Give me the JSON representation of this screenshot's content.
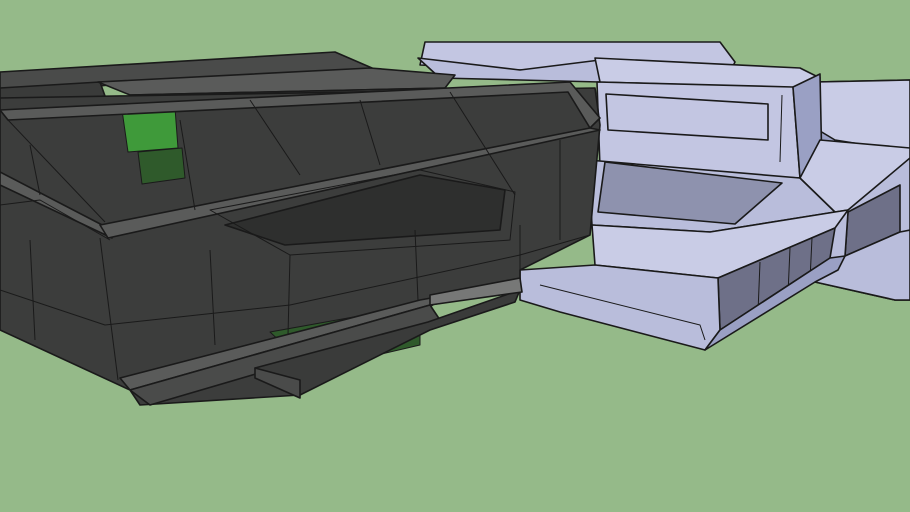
{
  "scene": {
    "description_label": "",
    "colors": {
      "background": "#95ba89",
      "dark_glass": "#3c3d3c",
      "dark_glass_deep": "#2e2f2e",
      "dark_frame": "#5a5b5a",
      "green_glass": "#2f5a2b",
      "green_highlight": "#3f9a3a",
      "light_hull": "#b9bddb",
      "light_hull_face": "#c9cce6",
      "light_hull_shadow": "#9aa0c4",
      "light_glass": "#6e7088",
      "edge": "#1a1a1a"
    }
  }
}
